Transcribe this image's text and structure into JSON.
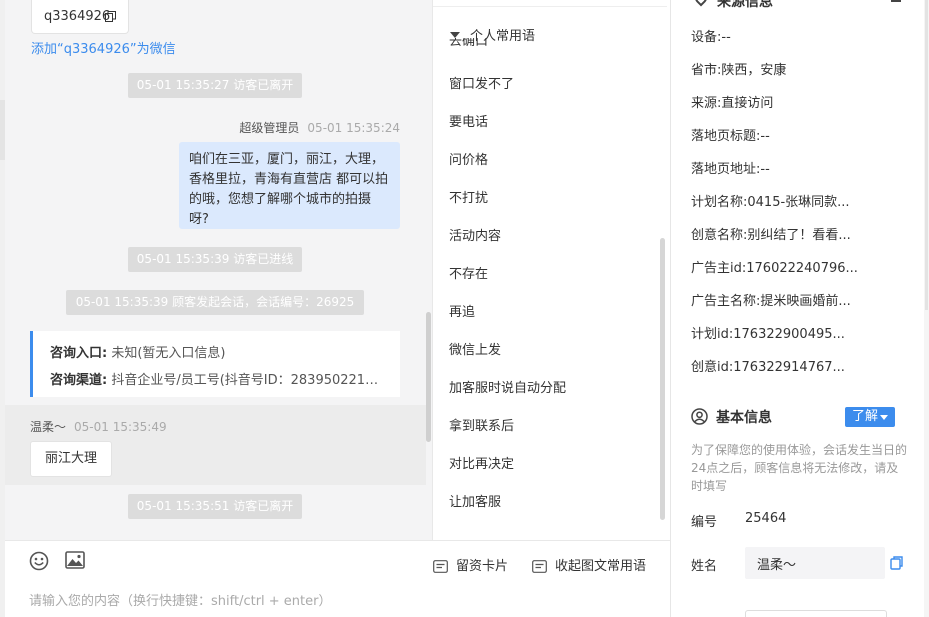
{
  "chat": {
    "copy_id": "q3364926",
    "add_wechat_link": "添加“q3364926”为微信",
    "system_messages": [
      "05-01 15:35:27 访客已离开",
      "05-01 15:35:39 访客已进线",
      "05-01 15:35:39 顾客发起会话，会话编号：26925",
      "05-01 15:35:51 访客已离开"
    ],
    "agent_message": {
      "sender": "超级管理员",
      "time": "05-01 15:35:24",
      "text": "咱们在三亚，厦门，丽江，大理，香格里拉，青海有直营店 都可以拍的哦，您想了解哪个城市的拍摄呀?"
    },
    "consult_card": {
      "entry_label": "咨询入口:",
      "entry_value": "未知(暂无入口信息)",
      "channel_label": "咨询渠道:",
      "channel_value": "抖音企业号/员工号(抖音号ID：283950221…"
    },
    "visitor_message": {
      "sender": "温柔～",
      "time": "05-01 15:35:49",
      "text": "丽江大理"
    }
  },
  "phrases": {
    "header": "个人常用语",
    "cut_item": "去确口",
    "items": [
      "窗口发不了",
      "要电话",
      "问价格",
      "不打扰",
      "活动内容",
      "不存在",
      "再追",
      "微信上发",
      "加客服时说自动分配",
      "拿到联系后",
      "对比再决定",
      "让加客服"
    ]
  },
  "input": {
    "placeholder": "请输入您的内容（换行快捷键：shift/ctrl + enter）",
    "card_button": "留资卡片",
    "collapse_button": "收起图文常用语"
  },
  "visitor_info": {
    "section_title": "来源信息",
    "fields": [
      {
        "label": "设备:",
        "value": "--"
      },
      {
        "label": "省市:",
        "value": "陕西，安康"
      },
      {
        "label": "来源:",
        "value": "直接访问"
      },
      {
        "label": "落地页标题:",
        "value": "--"
      },
      {
        "label": "落地页地址:",
        "value": "--"
      },
      {
        "label": "计划名称:",
        "value": "0415-张琳同款..."
      },
      {
        "label": "创意名称:",
        "value": "别纠结了！看看..."
      },
      {
        "label": "广告主id:",
        "value": "176022240796..."
      },
      {
        "label": "广告主名称:",
        "value": "提米映画婚前..."
      },
      {
        "label": "计划id:",
        "value": "176322900495..."
      },
      {
        "label": "创意id:",
        "value": "176322914767..."
      }
    ],
    "basic_title": "基本信息",
    "learn_button": "了解",
    "notice": "为了保障您的使用体验，会话发生当日的24点之后，顾客信息将无法修改，请及时填写",
    "number_label": "编号",
    "number_value": "25464",
    "name_label": "姓名",
    "name_value": "温柔～"
  },
  "colors": {
    "accent": "#3c8ced",
    "agent_bubble": "#dbe9fd",
    "system_pill": "#dcdcdc"
  }
}
